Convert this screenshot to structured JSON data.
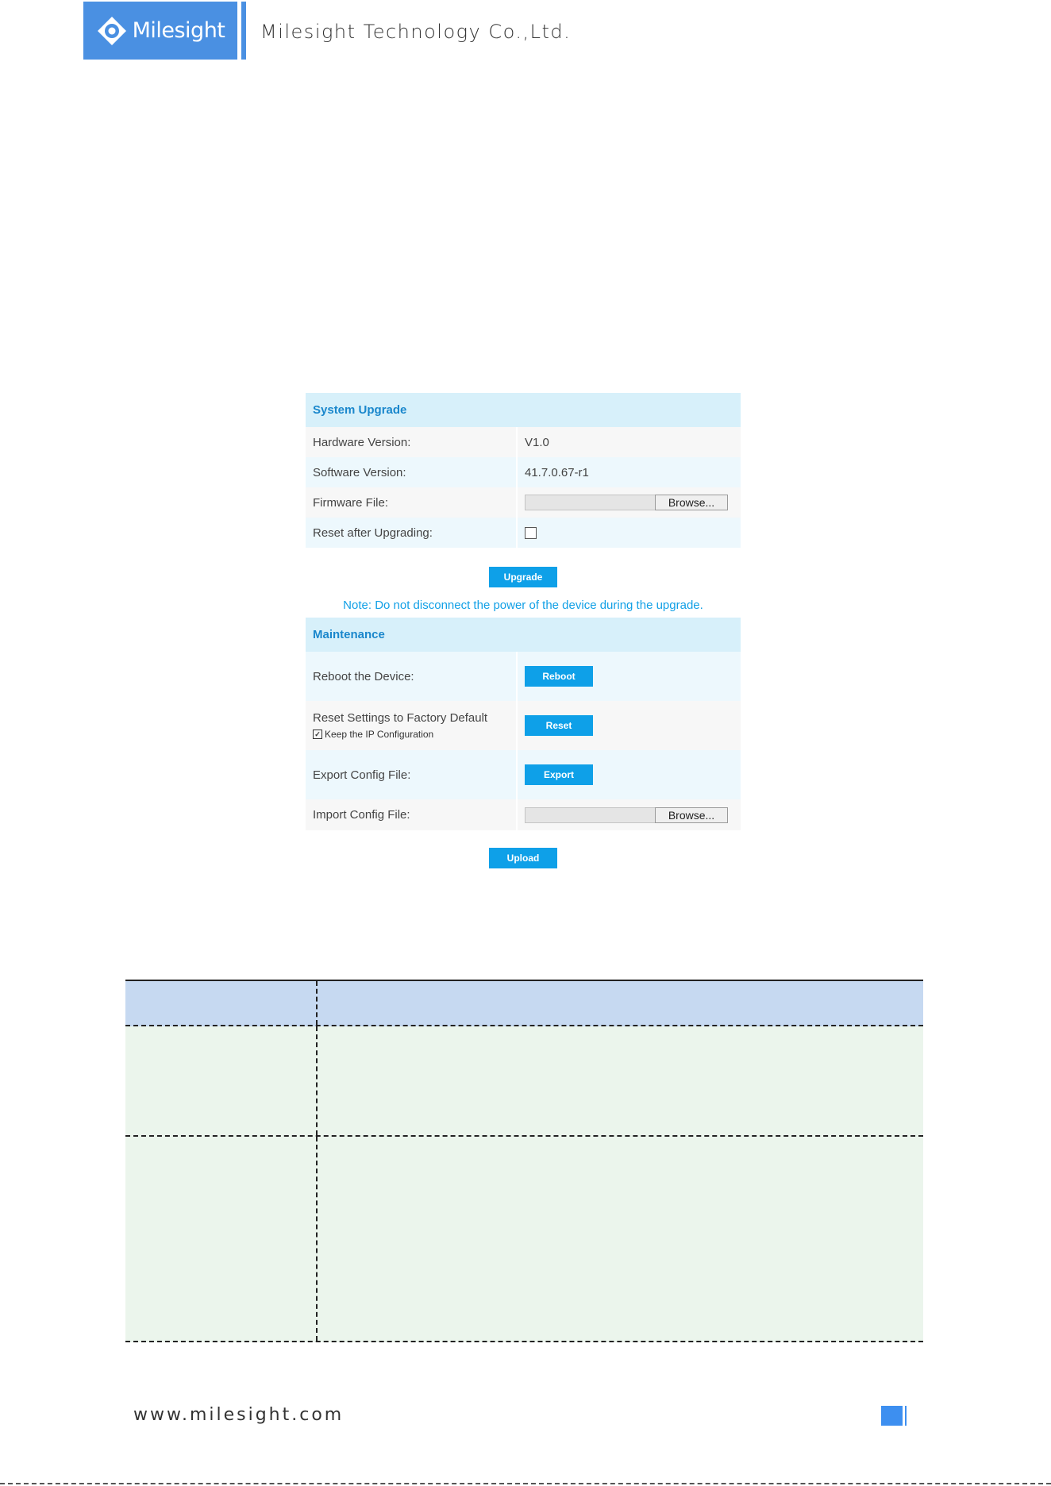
{
  "header": {
    "logo_text": "Milesight",
    "company_name": "Milesight Technology Co.,Ltd.",
    "brand_color": "#4a90e2"
  },
  "system_upgrade": {
    "title": "System Upgrade",
    "hardware_version_label": "Hardware Version:",
    "hardware_version_value": "V1.0",
    "software_version_label": "Software Version:",
    "software_version_value": "41.7.0.67-r1",
    "firmware_file_label": "Firmware File:",
    "firmware_browse_label": "Browse...",
    "reset_after_upgrading_label": "Reset after Upgrading:",
    "reset_after_upgrading_checked": false,
    "upgrade_button": "Upgrade",
    "note": "Note: Do not disconnect the power of the device during the upgrade."
  },
  "maintenance": {
    "title": "Maintenance",
    "reboot_label": "Reboot the Device:",
    "reboot_button": "Reboot",
    "reset_label": "Reset Settings to Factory Default",
    "keep_ip_label": "Keep the IP Configuration",
    "keep_ip_checked": true,
    "reset_button": "Reset",
    "export_label": "Export Config File:",
    "export_button": "Export",
    "import_label": "Import Config File:",
    "import_browse_label": "Browse...",
    "upload_button": "Upload"
  },
  "footer": {
    "url": "www.milesight.com"
  }
}
